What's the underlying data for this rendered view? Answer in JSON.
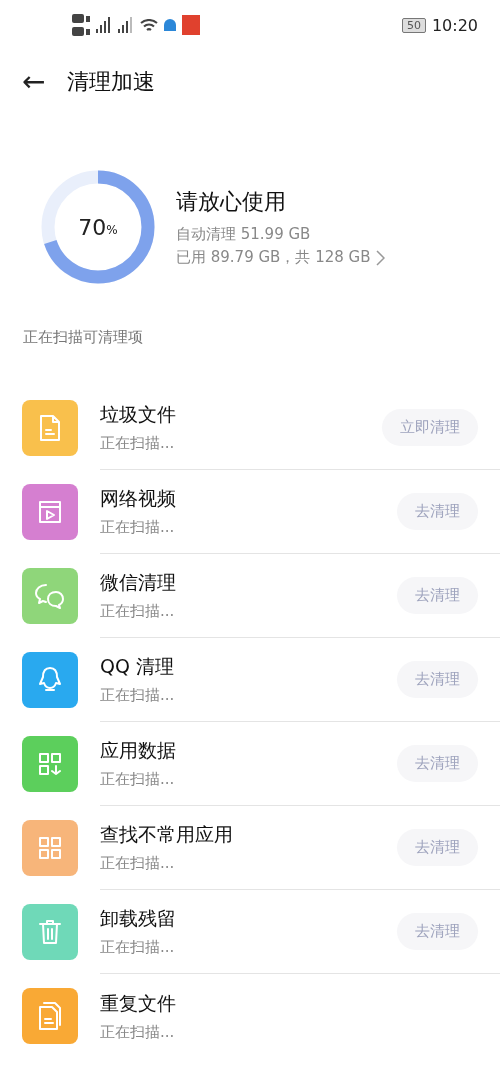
{
  "status_bar": {
    "battery": "50",
    "time": "10:20"
  },
  "header": {
    "back": "←",
    "title": "清理加速"
  },
  "summary": {
    "percent": "70",
    "percent_unit": "%",
    "level": 0.7,
    "headline": "请放心使用",
    "auto_clean": "自动清理 51.99 GB",
    "storage": "已用 89.79 GB，共 128 GB"
  },
  "section_title": "正在扫描可清理项",
  "items": [
    {
      "kind": "file",
      "color": "#f9c04c",
      "title": "垃圾文件",
      "status": "正在扫描...",
      "button": {
        "label": "立即清理",
        "disabled": true
      }
    },
    {
      "kind": "video",
      "color": "#d57fd0",
      "title": "网络视频",
      "status": "正在扫描...",
      "button": {
        "label": "去清理",
        "disabled": true
      }
    },
    {
      "kind": "chat",
      "color": "#8fd67a",
      "title": "微信清理",
      "status": "正在扫描...",
      "button": {
        "label": "去清理",
        "disabled": true
      }
    },
    {
      "kind": "bell",
      "color": "#29a9ef",
      "title": "QQ 清理",
      "status": "正在扫描...",
      "button": {
        "label": "去清理",
        "disabled": true
      }
    },
    {
      "kind": "grid-down",
      "color": "#5ccf5c",
      "title": "应用数据",
      "status": "正在扫描...",
      "button": {
        "label": "去清理",
        "disabled": true
      }
    },
    {
      "kind": "grid",
      "color": "#f7b57a",
      "title": "查找不常用应用",
      "status": "正在扫描...",
      "button": {
        "label": "去清理",
        "disabled": true
      }
    },
    {
      "kind": "trash",
      "color": "#6fd9b8",
      "title": "卸载残留",
      "status": "正在扫描...",
      "button": {
        "label": "去清理",
        "disabled": true
      }
    },
    {
      "kind": "files",
      "color": "#f9a935",
      "title": "重复文件",
      "status": "正在扫描..."
    }
  ]
}
